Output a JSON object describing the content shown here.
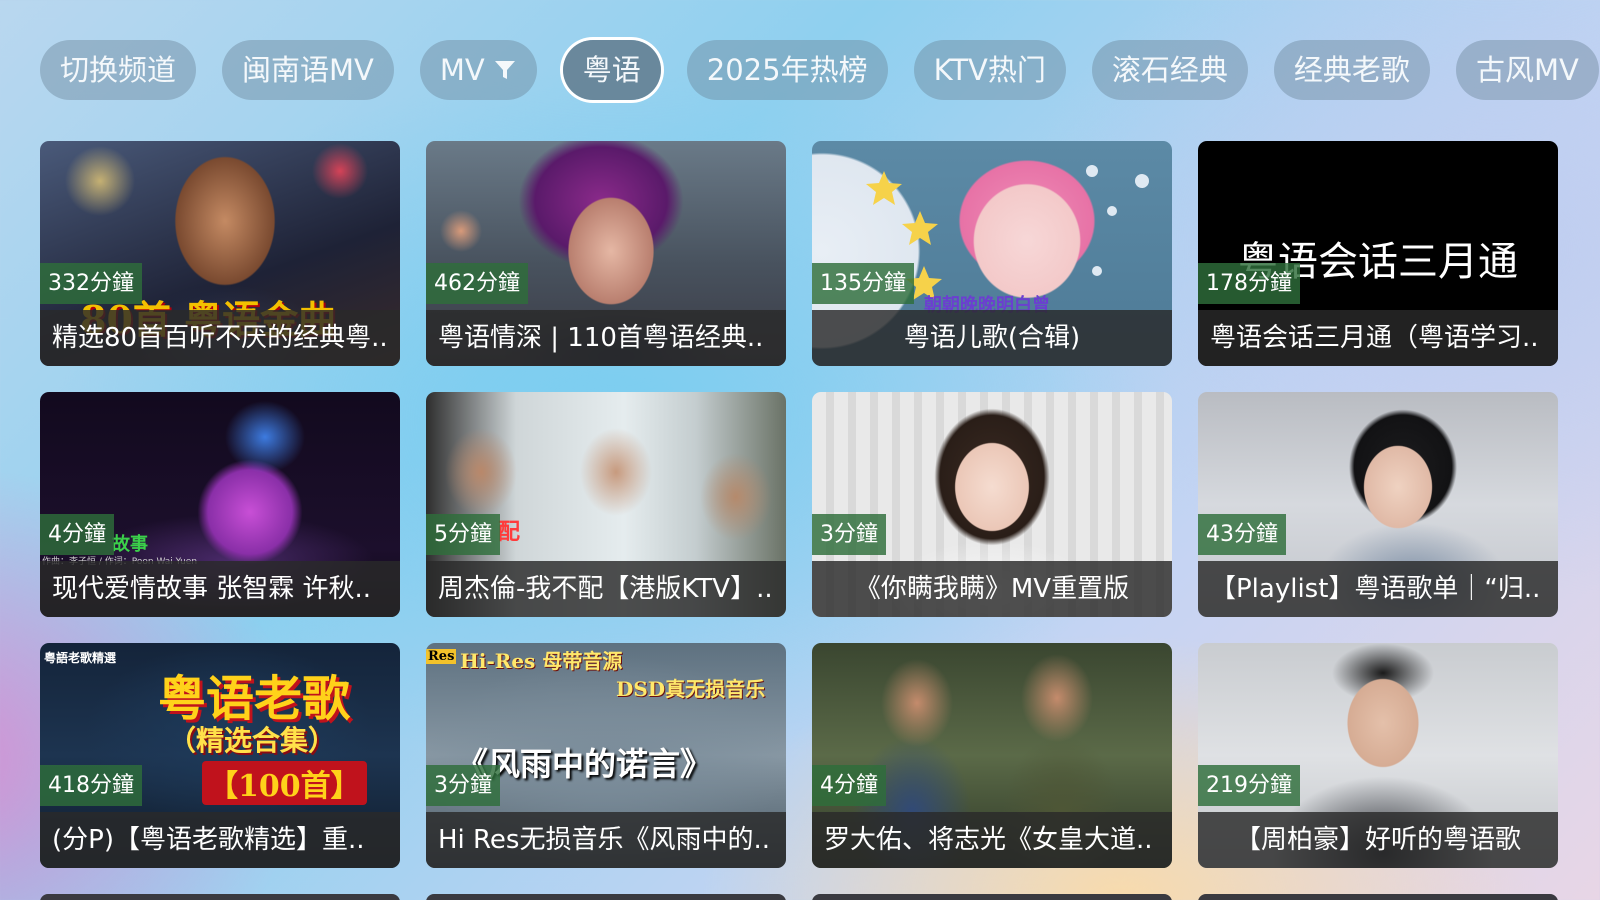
{
  "chips": [
    {
      "label": "切换频道",
      "active": false
    },
    {
      "label": "闽南语MV",
      "active": false
    },
    {
      "label": "MV",
      "active": false,
      "icon": "filter-icon"
    },
    {
      "label": "粤语",
      "active": true
    },
    {
      "label": "2025年热榜",
      "active": false
    },
    {
      "label": "KTV热门",
      "active": false
    },
    {
      "label": "滚石经典",
      "active": false
    },
    {
      "label": "经典老歌",
      "active": false
    },
    {
      "label": "古风MV",
      "active": false
    }
  ],
  "thumb_texts": {
    "c1": "80首 粤语金曲",
    "c3": "朝朝晚晚明白曾",
    "c4": "粤语会话三月通",
    "c5": "故事",
    "c5_credit": "作曲：李子恒 / 作词：Poon Wai Yuen",
    "c6": "配",
    "c9_title": "粤语老歌",
    "c9_sub": "（精选合集）",
    "c9_count": "【100首】",
    "c9_corner": "粤語老歌精選",
    "c10_top": "Hi-Res 母带音源",
    "c10_line2": "DSD真无损音乐",
    "c10_title": "《风雨中的诺言》",
    "c10_badge": "Res"
  },
  "cards": [
    {
      "duration": "332分鐘",
      "title": "精选80首百听不厌的经典粤.."
    },
    {
      "duration": "462分鐘",
      "title": "粤语情深 | 110首粤语经典.."
    },
    {
      "duration": "135分鐘",
      "title": "粤语儿歌(合辑)"
    },
    {
      "duration": "178分鐘",
      "title": "粤语会话三月通（粤语学习.."
    },
    {
      "duration": "4分鐘",
      "title": "现代爱情故事 张智霖 许秋.."
    },
    {
      "duration": "5分鐘",
      "title": "周杰倫-我不配【港版KTV】.."
    },
    {
      "duration": "3分鐘",
      "title": "《你瞒我瞒》MV重置版"
    },
    {
      "duration": "43分鐘",
      "title": "【Playlist】粤语歌单｜“归.."
    },
    {
      "duration": "418分鐘",
      "title": "(分P)【粤语老歌精选】重.."
    },
    {
      "duration": "3分鐘",
      "title": "Hi Res无损音乐《风雨中的.."
    },
    {
      "duration": "4分鐘",
      "title": "罗大佑、将志光《女皇大道.."
    },
    {
      "duration": "219分鐘",
      "title": "【周柏豪】好听的粤语歌"
    }
  ],
  "colors": {
    "duration_badge": "#2e6e3a",
    "caption_bg": "#2a2a2a",
    "chip_bg": "#69829a",
    "active_ring": "#ffffff"
  }
}
